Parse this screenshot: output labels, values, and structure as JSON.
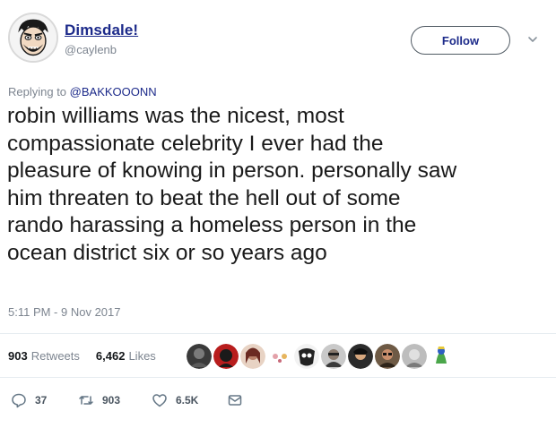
{
  "author": {
    "display_name": "Dimsdale!",
    "username": "@caylenb",
    "avatar_icon": "cartoon-face-avatar",
    "name_color": "#1c2a8a"
  },
  "header": {
    "follow_label": "Follow",
    "caret_icon": "chevron-down-icon"
  },
  "reply": {
    "prefix": "Replying to",
    "mention": "@BAKKOOONN"
  },
  "tweet": {
    "text": "robin williams was the nicest, most\ncompassionate celebrity I ever had the\npleasure of knowing in person. personally saw\nhim threaten to beat the hell out of some\nrando harassing a homeless person in the\nocean district six or so years ago",
    "timestamp": "5:11 PM - 9 Nov 2017"
  },
  "stats": {
    "retweets_count": "903",
    "retweets_label": "Retweets",
    "likes_count": "6,462",
    "likes_label": "Likes",
    "liker_avatars": [
      "liker-avatar-1",
      "liker-avatar-2",
      "liker-avatar-3",
      "liker-avatar-4",
      "liker-avatar-5",
      "liker-avatar-6",
      "liker-avatar-7",
      "liker-avatar-8",
      "liker-avatar-9",
      "liker-avatar-10"
    ]
  },
  "actions": {
    "reply_count": "37",
    "retweet_count": "903",
    "like_count": "6.5K",
    "reply_icon": "reply-icon",
    "retweet_icon": "retweet-icon",
    "like_icon": "heart-icon",
    "message_icon": "envelope-icon"
  }
}
